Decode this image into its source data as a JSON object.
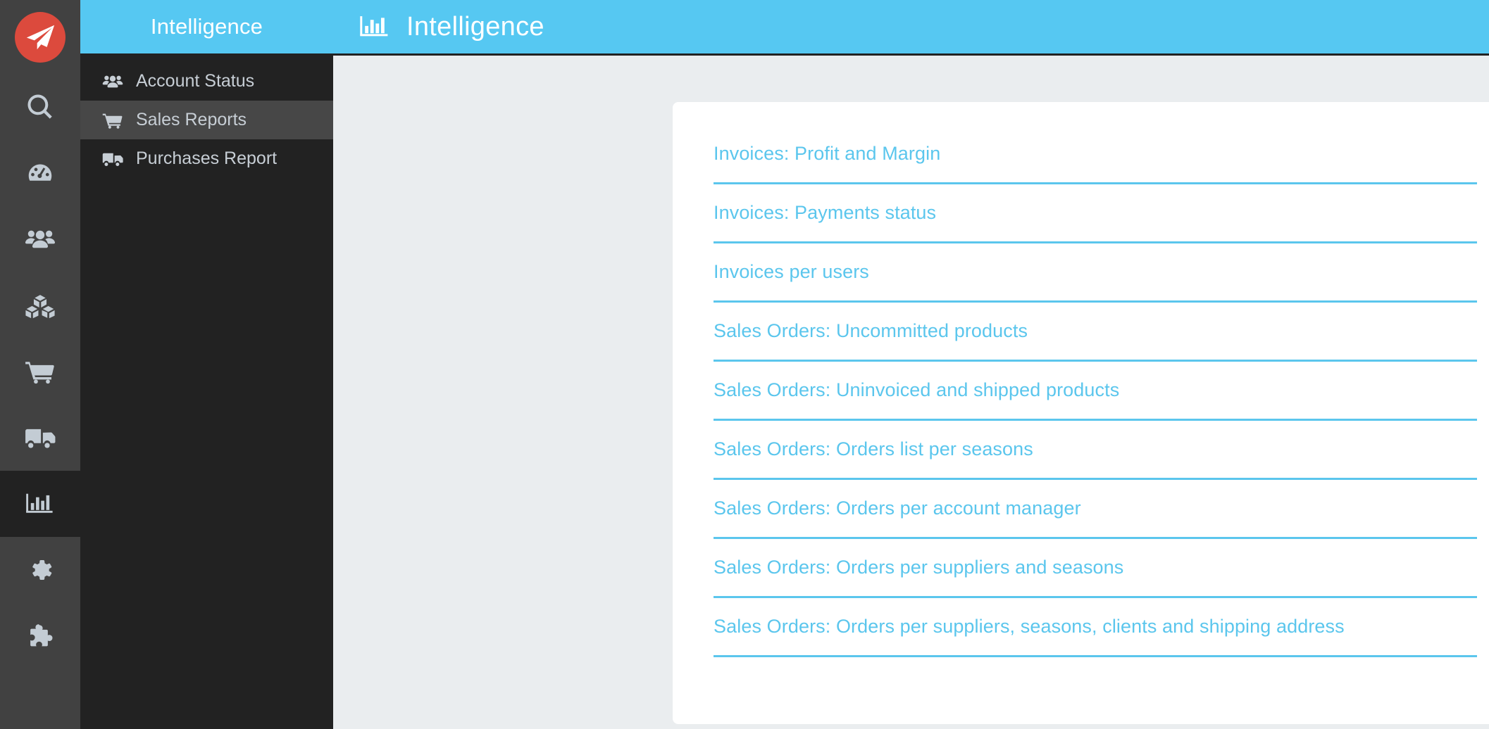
{
  "brand": {
    "logo_icon": "paper-plane-icon",
    "logo_bg": "#dc4a3d"
  },
  "colors": {
    "accent_blue": "#56c8f2",
    "link_blue": "#5bc6ed",
    "rail_bg": "#414141",
    "menu_bg": "#222222",
    "menu_active": "#474747",
    "content_bg": "#eaedef",
    "card_bg": "#ffffff"
  },
  "icon_rail": {
    "items": [
      {
        "icon": "search-icon",
        "active": false
      },
      {
        "icon": "dashboard-gauge-icon",
        "active": false
      },
      {
        "icon": "users-group-icon",
        "active": false
      },
      {
        "icon": "cubes-icon",
        "active": false
      },
      {
        "icon": "shopping-cart-icon",
        "active": false
      },
      {
        "icon": "truck-icon",
        "active": false
      },
      {
        "icon": "bar-chart-icon",
        "active": true
      },
      {
        "icon": "gear-icon",
        "active": false
      },
      {
        "icon": "puzzle-piece-icon",
        "active": false
      }
    ]
  },
  "sidebar": {
    "title": "Intelligence",
    "items": [
      {
        "label": "Account Status",
        "icon": "users-group-icon",
        "active": false
      },
      {
        "label": "Sales Reports",
        "icon": "shopping-cart-icon",
        "active": true
      },
      {
        "label": "Purchases Report",
        "icon": "truck-icon",
        "active": false
      }
    ]
  },
  "header": {
    "icon": "bar-chart-icon",
    "title": "Intelligence"
  },
  "main": {
    "reports": [
      {
        "label": "Invoices: Profit and Margin"
      },
      {
        "label": "Invoices: Payments status"
      },
      {
        "label": "Invoices per users"
      },
      {
        "label": "Sales Orders: Uncommitted products"
      },
      {
        "label": "Sales Orders: Uninvoiced and shipped products"
      },
      {
        "label": "Sales Orders: Orders list per seasons"
      },
      {
        "label": "Sales Orders: Orders per account manager"
      },
      {
        "label": "Sales Orders: Orders per suppliers and seasons"
      },
      {
        "label": "Sales Orders: Orders per suppliers, seasons, clients and shipping address"
      }
    ]
  }
}
